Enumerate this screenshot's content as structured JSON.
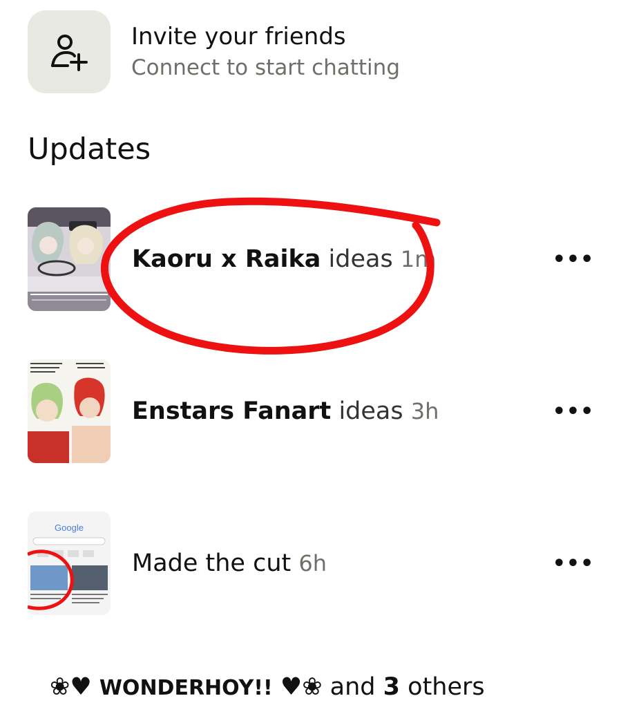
{
  "invite": {
    "title": "Invite your friends",
    "subtitle": "Connect to start chatting",
    "icon": "add-person-icon"
  },
  "updates": {
    "heading": "Updates",
    "items": [
      {
        "board_name": "Kaoru x Raika",
        "suffix": "ideas",
        "time": "1m",
        "more_label": "•••",
        "thumbnail": "anime-car-scene"
      },
      {
        "board_name": "Enstars Fanart",
        "suffix": "ideas",
        "time": "3h",
        "more_label": "•••",
        "thumbnail": "anime-two-characters"
      },
      {
        "board_name": "",
        "suffix": "Made the cut",
        "time": "6h",
        "more_label": "•••",
        "thumbnail": "google-search-screenshot",
        "thumbnail_text": "Google"
      }
    ]
  },
  "participants": {
    "prefix_symbols": "❀♥",
    "name": "WONDERHOY!!",
    "suffix_symbols": "♥❀",
    "joiner": "and",
    "count": "3",
    "others_label": "others"
  },
  "colors": {
    "annotation_red": "#ee1111",
    "icon_box_bg": "#e9e9e3",
    "muted_text": "#6f6f6a"
  }
}
